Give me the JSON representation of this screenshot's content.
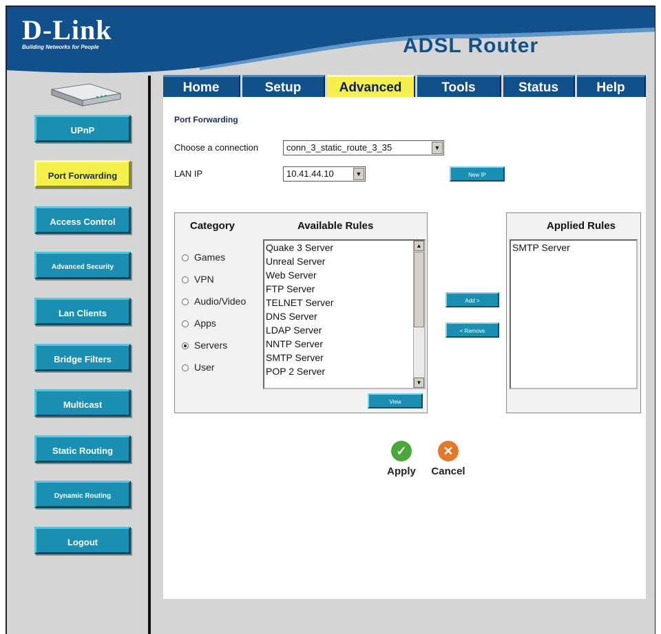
{
  "header": {
    "logo_text": "D-Link",
    "logo_tagline": "Building Networks for People",
    "product_title": "ADSL Router"
  },
  "sidebar": {
    "items": [
      {
        "label": "UPnP"
      },
      {
        "label": "Port Forwarding"
      },
      {
        "label": "Access Control"
      },
      {
        "label": "Advanced Security"
      },
      {
        "label": "Lan Clients"
      },
      {
        "label": "Bridge Filters"
      },
      {
        "label": "Multicast"
      },
      {
        "label": "Static Routing"
      },
      {
        "label": "Dynamic Routing"
      },
      {
        "label": "Logout"
      }
    ],
    "active": "Port Forwarding"
  },
  "tabs": [
    {
      "label": "Home"
    },
    {
      "label": "Setup"
    },
    {
      "label": "Advanced"
    },
    {
      "label": "Tools"
    },
    {
      "label": "Status"
    },
    {
      "label": "Help"
    }
  ],
  "active_tab": "Advanced",
  "main": {
    "section_title": "Port Forwarding",
    "connection_label": "Choose a connection",
    "connection_value": "conn_3_static_route_3_35",
    "lanip_label": "LAN IP",
    "lanip_value": "10.41.44.10",
    "new_ip_button": "New IP",
    "category_header": "Category",
    "available_header": "Available Rules",
    "applied_header": "Applied Rules",
    "categories": [
      {
        "label": "Games",
        "selected": false
      },
      {
        "label": "VPN",
        "selected": false
      },
      {
        "label": "Audio/Video",
        "selected": false
      },
      {
        "label": "Apps",
        "selected": false
      },
      {
        "label": "Servers",
        "selected": true
      },
      {
        "label": "User",
        "selected": false
      }
    ],
    "available_rules": [
      "Quake 3 Server",
      "Unreal Server",
      "Web Server",
      "FTP Server",
      "TELNET Server",
      "DNS Server",
      "LDAP Server",
      "NNTP Server",
      "SMTP Server",
      "POP 2 Server"
    ],
    "applied_rules": [
      "SMTP Server"
    ],
    "view_button": "View",
    "add_button": "Add >",
    "remove_button": "< Remove",
    "apply_label": "Apply",
    "cancel_label": "Cancel"
  },
  "colors": {
    "brand_blue": "#12508c",
    "button_teal": "#1a8fb2",
    "highlight_yellow": "#f5f04a",
    "apply_green": "#4aa83a",
    "cancel_orange": "#e2782a"
  }
}
